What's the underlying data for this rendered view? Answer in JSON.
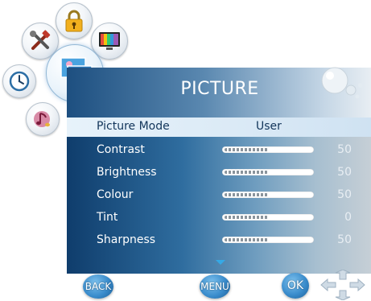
{
  "header": {
    "title": "PICTURE"
  },
  "menu_wheel": {
    "items": [
      {
        "icon": "lock-icon"
      },
      {
        "icon": "tools-icon"
      },
      {
        "icon": "tv-screen-icon"
      },
      {
        "icon": "picture-icon",
        "active": true
      },
      {
        "icon": "clock-icon"
      },
      {
        "icon": "music-note-icon"
      }
    ]
  },
  "settings": {
    "picture_mode": {
      "label": "Picture Mode",
      "value": "User"
    },
    "rows": [
      {
        "label": "Contrast",
        "value": "50",
        "level": 0.5
      },
      {
        "label": "Brightness",
        "value": "50",
        "level": 0.5
      },
      {
        "label": "Colour",
        "value": "50",
        "level": 0.5
      },
      {
        "label": "Tint",
        "value": "0",
        "level": 0.5
      },
      {
        "label": "Sharpness",
        "value": "50",
        "level": 0.5
      }
    ]
  },
  "buttons": {
    "back": "BACK",
    "menu": "MENU",
    "ok": "OK"
  },
  "colors": {
    "panel_dark": "#0f3d6c",
    "highlight": "#dbeaf6",
    "button": "#3a8ccc"
  }
}
